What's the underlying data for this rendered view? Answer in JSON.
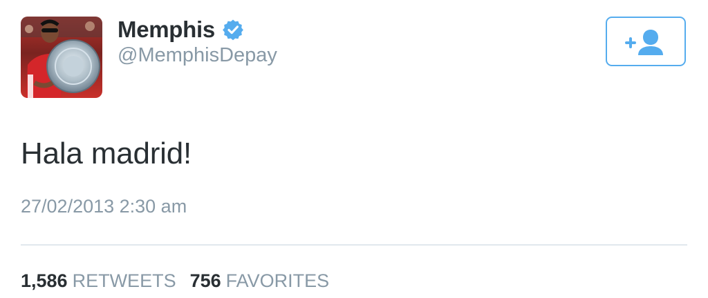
{
  "user": {
    "display_name": "Memphis",
    "handle": "@MemphisDepay",
    "verified": true,
    "avatar_icon": "profile-photo-holding-trophy-plate"
  },
  "follow_button": {
    "icon": "add-user-icon",
    "color": "#55acee"
  },
  "tweet": {
    "text": "Hala madrid!",
    "timestamp": "27/02/2013 2:30 am"
  },
  "stats": {
    "retweets_count": "1,586",
    "retweets_label": "RETWEETS",
    "favorites_count": "756",
    "favorites_label": "FAVORITES"
  },
  "colors": {
    "text_primary": "#292f33",
    "text_secondary": "#8899a6",
    "accent": "#55acee",
    "divider": "#e1e8ed"
  }
}
